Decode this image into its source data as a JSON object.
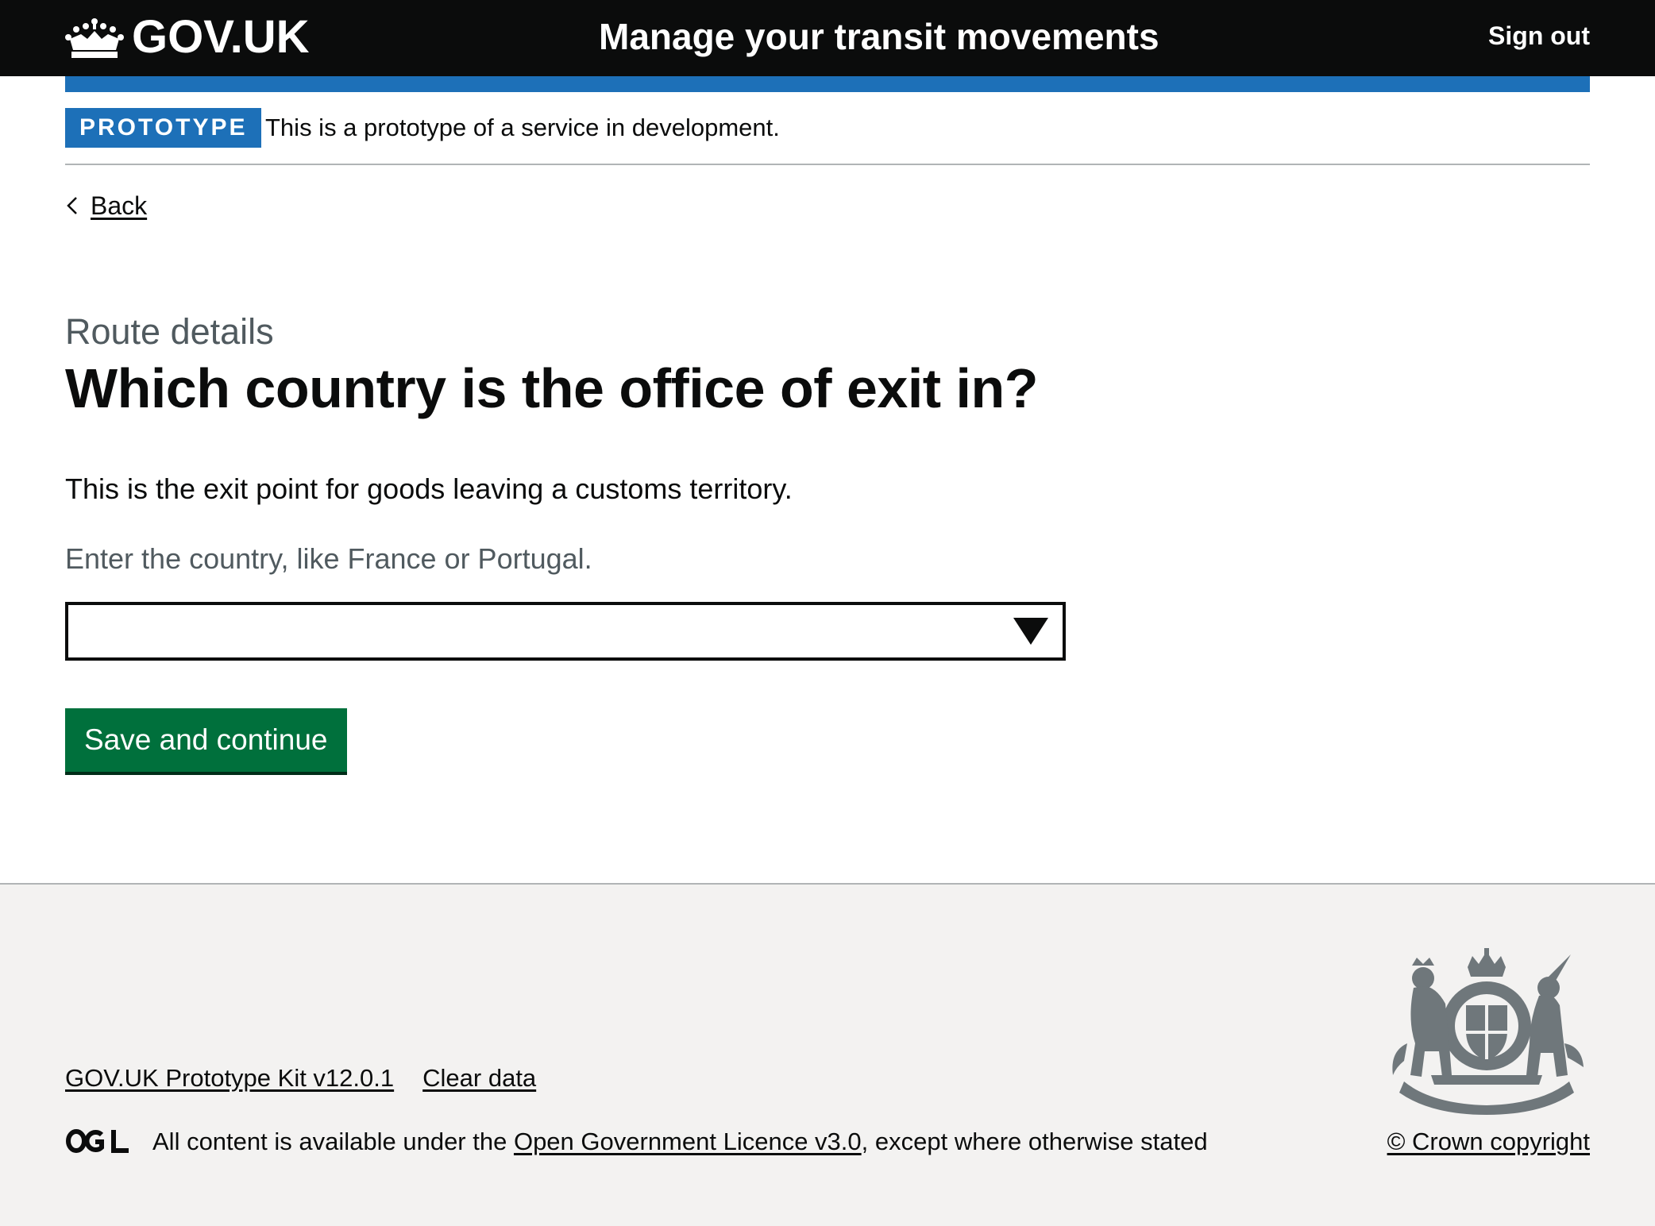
{
  "header": {
    "logo_text": "GOV.UK",
    "service_name": "Manage your transit movements",
    "sign_out": "Sign out"
  },
  "phase_banner": {
    "tag": "PROTOTYPE",
    "text": "This is a prototype of a service in development."
  },
  "back_link": "Back",
  "main": {
    "caption": "Route details",
    "heading": "Which country is the office of exit in?",
    "body": "This is the exit point for goods leaving a customs territory.",
    "hint": "Enter the country, like France or Portugal.",
    "select_value": "",
    "button": "Save and continue"
  },
  "footer": {
    "links": [
      "GOV.UK Prototype Kit v12.0.1",
      "Clear data"
    ],
    "licence_prefix": "All content is available under the ",
    "licence_link": "Open Government Licence v3.0",
    "licence_suffix": ", except where otherwise stated",
    "copyright": "© Crown copyright"
  },
  "colors": {
    "header_bg": "#0b0c0c",
    "brand_blue": "#1d70b8",
    "button_green": "#00703c",
    "secondary_text": "#505a5f",
    "footer_bg": "#f3f2f1"
  },
  "icons": [
    "crown-icon",
    "back-chevron-icon",
    "dropdown-arrow-icon",
    "ogl-logo",
    "royal-coat-of-arms"
  ]
}
